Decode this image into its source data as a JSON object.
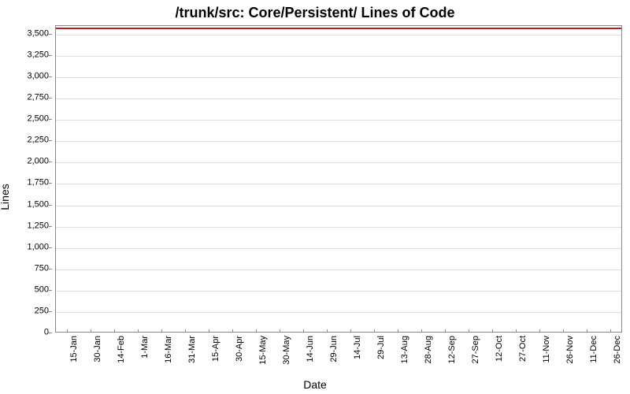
{
  "chart_data": {
    "type": "line",
    "title": "/trunk/src: Core/Persistent/ Lines of Code",
    "xlabel": "Date",
    "ylabel": "Lines",
    "ylim": [
      0,
      3600
    ],
    "y_ticks": [
      0,
      250,
      500,
      750,
      1000,
      1250,
      1500,
      1750,
      2000,
      2250,
      2500,
      2750,
      3000,
      3250,
      3500
    ],
    "y_tick_labels": [
      "0",
      "250",
      "500",
      "750",
      "1,000",
      "1,250",
      "1,500",
      "1,750",
      "2,000",
      "2,250",
      "2,500",
      "2,750",
      "3,000",
      "3,250",
      "3,500"
    ],
    "categories": [
      "15-Jan",
      "30-Jan",
      "14-Feb",
      "1-Mar",
      "16-Mar",
      "31-Mar",
      "15-Apr",
      "30-Apr",
      "15-May",
      "30-May",
      "14-Jun",
      "29-Jun",
      "14-Jul",
      "29-Jul",
      "13-Aug",
      "28-Aug",
      "12-Sep",
      "27-Sep",
      "12-Oct",
      "27-Oct",
      "11-Nov",
      "26-Nov",
      "11-Dec",
      "26-Dec"
    ],
    "series": [
      {
        "name": "Lines of Code",
        "color": "#b22222",
        "values": [
          3580,
          3580,
          3580,
          3580,
          3580,
          3580,
          3580,
          3580,
          3580,
          3580,
          3580,
          3580,
          3580,
          3580,
          3580,
          3580,
          3580,
          3580,
          3580,
          3580,
          3580,
          3580,
          3580,
          3580
        ]
      }
    ]
  }
}
